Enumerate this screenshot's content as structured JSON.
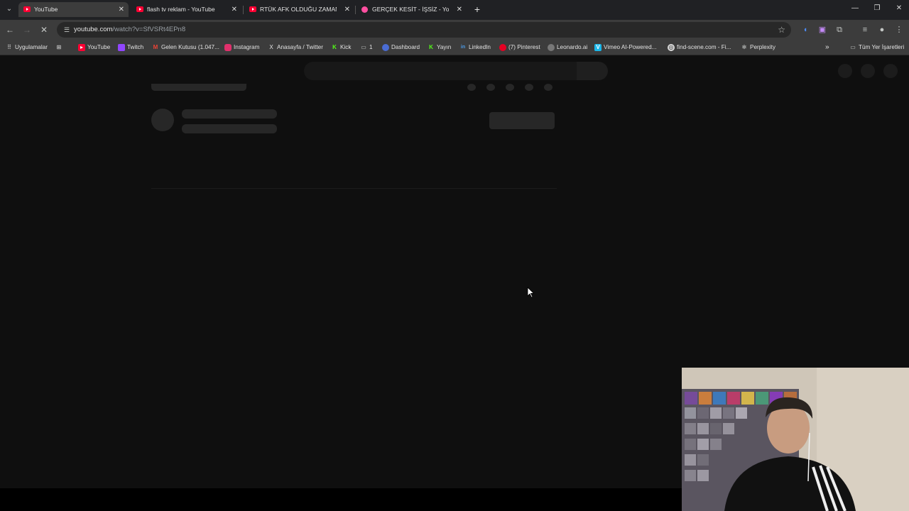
{
  "tabs": [
    {
      "title": "YouTube",
      "active": true,
      "favicon": "youtube-icon"
    },
    {
      "title": "flash tv reklam - YouTube",
      "active": false,
      "favicon": "youtube-icon"
    },
    {
      "title": "RTÜK AFK OLDUĞU ZAMANLA",
      "active": false,
      "favicon": "youtube-icon"
    },
    {
      "title": "GERÇEK KESİT - İŞSİZ - YouTube",
      "active": false,
      "favicon": "audio-icon"
    }
  ],
  "address_bar": {
    "domain": "youtube.com",
    "path": "/watch?v=SfVSRt4EPn8"
  },
  "bookmarks": {
    "apps": "Uygulamalar",
    "items": [
      {
        "label": "YouTube",
        "icon": "youtube-icon",
        "color": "#ff0033"
      },
      {
        "label": "Twitch",
        "icon": "twitch-icon",
        "color": "#9146ff"
      },
      {
        "label": "Gelen Kutusu (1.047...",
        "icon": "gmail-icon",
        "color": "#ea4335"
      },
      {
        "label": "Instagram",
        "icon": "instagram-icon",
        "color": "#e1306c"
      },
      {
        "label": "Anasayfa / Twitter",
        "icon": "x-icon",
        "color": "#000000"
      },
      {
        "label": "Kick",
        "icon": "kick-icon",
        "color": "#53fc18"
      },
      {
        "label": "1",
        "icon": "folder-icon",
        "color": "#3c3c3c"
      },
      {
        "label": "Dashboard",
        "icon": "dashboard-icon",
        "color": "#4a6cd4"
      },
      {
        "label": "Yayın",
        "icon": "kick-icon",
        "color": "#53fc18"
      },
      {
        "label": "LinkedIn",
        "icon": "linkedin-icon",
        "color": "#0a66c2"
      },
      {
        "label": "(7) Pinterest",
        "icon": "pinterest-icon",
        "color": "#e60023"
      },
      {
        "label": "Leonardo.ai",
        "icon": "leonardo-icon",
        "color": "#777777"
      },
      {
        "label": "Vimeo AI-Powered...",
        "icon": "vimeo-icon",
        "color": "#1ab7ea"
      },
      {
        "label": "find-scene.com - Fi...",
        "icon": "findscene-icon",
        "color": "#dddddd"
      },
      {
        "label": "Perplexity",
        "icon": "perplexity-icon",
        "color": "#555555"
      }
    ],
    "all_bookmarks": "Tüm Yer İşaretleri"
  },
  "colors": {
    "page_bg": "#0f0f0f",
    "skeleton": "#272727",
    "chrome_bar": "#3c3c3c",
    "tabstrip": "#202124"
  }
}
